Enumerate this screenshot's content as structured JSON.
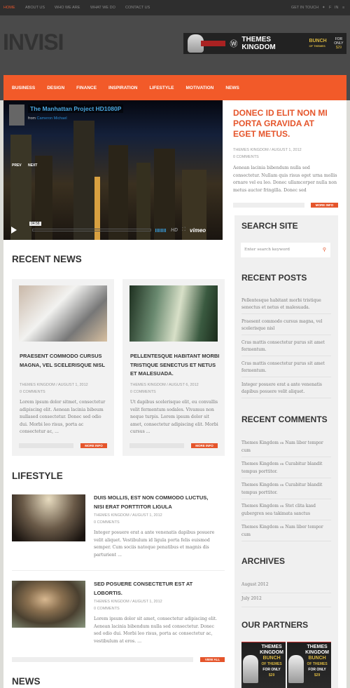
{
  "topbar": {
    "items": [
      "HOME",
      "ABOUT US",
      "WHO WE ARE",
      "WHAT WE DO",
      "CONTACT US"
    ],
    "get_in_touch": "GET IN TOUCH",
    "social_icons": [
      "twitter-icon",
      "facebook-icon",
      "linkedin-icon",
      "rss-icon"
    ],
    "active_color": "#e5552b"
  },
  "header": {
    "logo": "INVISI",
    "banner": {
      "brand": "THEMES KINGDOM",
      "line1": "BUNCH",
      "line2": "OF THEMES",
      "price_label": "FOR ONLY",
      "price": "$29"
    }
  },
  "nav": {
    "items": [
      "BUSINESS",
      "DESIGN",
      "FINANCE",
      "INSPIRATION",
      "LIFESTYLE",
      "MOTIVATION",
      "NEWS"
    ],
    "color": "#f25a29"
  },
  "video": {
    "title": "The Manhattan Project HD1080P",
    "from": "from",
    "author": "Cameron Michael",
    "prev": "PREV",
    "next": "NEXT",
    "time": "04:58",
    "hd": "HD",
    "brand": "vimeo"
  },
  "featured": {
    "title": "DONEC ID ELIT NON MI PORTA GRAVIDA AT EGET METUS.",
    "meta": "THEMES KINGDOM / AUGUST 1, 2012",
    "comments": "0 COMMENTS",
    "excerpt": "Aenean lacinia bibendum nulla sed consectetur. Nullam quis risus eget urna mollis ornare vel eu leo. Donec ullamcorper nulla non metus auctor fringilla. Donec sed",
    "more": "MORE INFO"
  },
  "recent_news": {
    "heading": "RECENT NEWS",
    "cards": [
      {
        "title": "PRAESENT COMMODO CURSUS MAGNA, VEL SCELERISQUE NISL",
        "meta": "THEMES KINGDOM / AUGUST 1, 2012",
        "comments": "0 COMMENTS",
        "excerpt": "Lorem ipsum dolor sitmet, consectetur adipiscing elit. Aenean lacinia bibeum nullased consectetur. Donec sed odio dui. Morbi leo risus, porta ac consectetur ac, ...",
        "more": "MORE INFO"
      },
      {
        "title": "PELLENTESQUE HABITANT MORBI TRISTIQUE SENECTUS ET NETUS ET MALESUADA.",
        "meta": "THEMES KINGDOM / AUGUST 6, 2012",
        "comments": "0 COMMENTS",
        "excerpt": "Ut dapibus scelerisque elit, eu convallis velit fermentum sodales. Vivamus non neque turpis. Lorem ipsum dolor sit amet, consectetur adipiscing elit. Morbi cursus ...",
        "more": "MORE INFO"
      }
    ]
  },
  "lifestyle": {
    "heading": "LIFESTYLE",
    "items": [
      {
        "title": "DUIS MOLLIS, EST NON COMMODO LUCTUS, NISI ERAT PORTTITOR LIGULA",
        "meta": "THEMES KINGDOM / AUGUST 1, 2012",
        "comments": "0 COMMENTS",
        "excerpt": "Integer posuere erat a ante venenatis dapibus posuere velit aliquet.   Vestibulum id ligula porta felis euismod semper. Cum sociis natoque penatibus et magnis dis parturient ..."
      },
      {
        "title": "SED POSUERE CONSECTETUR EST AT LOBORTIS.",
        "meta": "THEMES KINGDOM / AUGUST 1, 2012",
        "comments": "0 COMMENTS",
        "excerpt": "Lorem ipsum dolor sit amet, consectetur adipiscing elit. Aenean lacinia bibendum nulla sed consectetur. Donec sed odio dui. Morbi leo risus, porta ac consectetur ac, vestibulum at eros. ..."
      }
    ],
    "view_all": "VIEW ALL"
  },
  "news": {
    "heading": "NEWS"
  },
  "sidebar": {
    "search": {
      "heading": "SEARCH SITE",
      "placeholder": "Enter search keyword"
    },
    "recent_posts": {
      "heading": "RECENT POSTS",
      "items": [
        "Pellentesque habitant morbi tristique senectus et netus et malesuada.",
        "Praesent commodo cursus magna, vel scelerisque nisl",
        "Cras mattis consectetur purus sit amet fermentum.",
        "Cras mattis consectetur purus sit amet fermentum.",
        "Integer posuere erat a ante venenatis dapibus posuere velit aliquet."
      ]
    },
    "recent_comments": {
      "heading": "RECENT COMMENTS",
      "on": "on",
      "items": [
        {
          "author": "Themes Kingdom",
          "post": "Nam liber tempor cum"
        },
        {
          "author": "Themes Kingdom",
          "post": "Curabitur blandit tempus porttitor."
        },
        {
          "author": "Themes Kingdom",
          "post": "Curabitur blandit tempus porttitor."
        },
        {
          "author": "Themes Kingdom",
          "post": "Stet clita kasd gubergren sea takimata sanctus"
        },
        {
          "author": "Themes Kingdom",
          "post": "Nam liber tempor cum"
        }
      ]
    },
    "archives": {
      "heading": "ARCHIVES",
      "items": [
        "August 2012",
        "July 2012"
      ]
    },
    "partners": {
      "heading": "OUR PARTNERS",
      "ad": {
        "line1": "THEMES",
        "line2": "KINGDOM",
        "line3": "BUNCH",
        "line4": "OF THEMES",
        "line5": "FOR ONLY",
        "price": "$29"
      }
    }
  }
}
